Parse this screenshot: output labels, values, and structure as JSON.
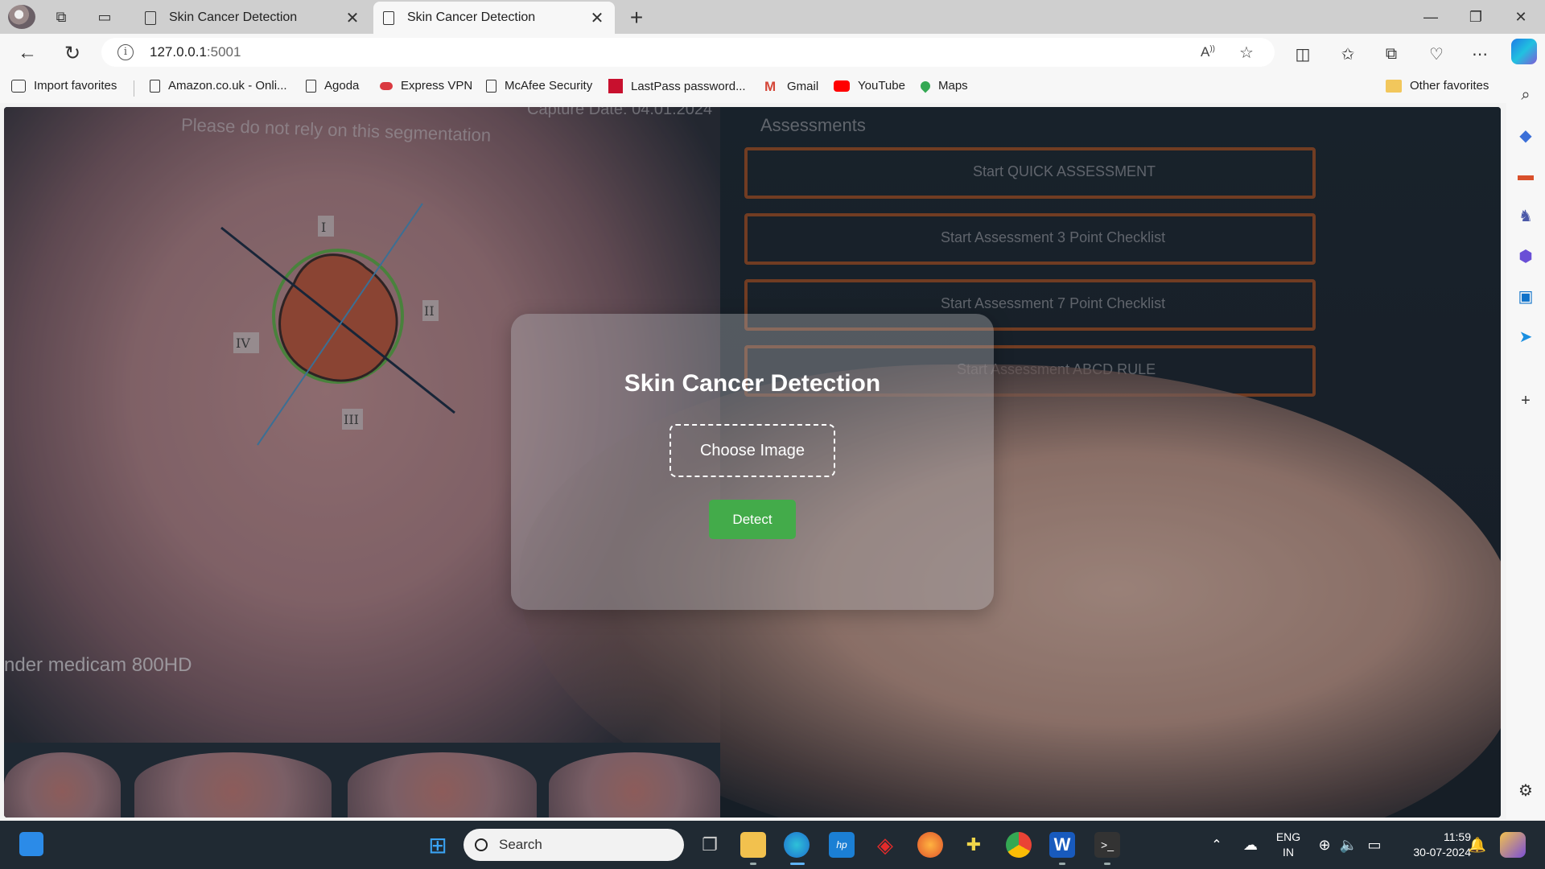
{
  "browser": {
    "tabs": [
      {
        "label": "Skin Cancer Detection",
        "active": false
      },
      {
        "label": "Skin Cancer Detection",
        "active": true
      }
    ],
    "new_tab": "+",
    "address": {
      "host": "127.0.0.1",
      "port": ":5001"
    },
    "favorites": [
      {
        "label": "Import favorites",
        "icon": "import-icon"
      },
      {
        "label": "Amazon.co.uk - Onli...",
        "icon": "page-icon"
      },
      {
        "label": "Agoda",
        "icon": "page-icon"
      },
      {
        "label": "Express VPN",
        "icon": "expressvpn-icon"
      },
      {
        "label": "McAfee Security",
        "icon": "page-icon"
      },
      {
        "label": "LastPass password...",
        "icon": "lastpass-icon"
      },
      {
        "label": "Gmail",
        "icon": "gmail-icon"
      },
      {
        "label": "YouTube",
        "icon": "youtube-icon"
      },
      {
        "label": "Maps",
        "icon": "maps-icon"
      }
    ],
    "other_favorites": "Other favorites"
  },
  "background": {
    "top_text": "Please do not rely on this segmentation",
    "capture_text": "Capture Date: 04.01.2024",
    "assessments_title": "Assessments",
    "device_text": "nder medicam 800HD",
    "assessment_items": [
      "Start QUICK ASSESSMENT",
      "Start Assessment 3 Point Checklist",
      "Start Assessment 7 Point Checklist",
      "Start Assessment ABCD RULE"
    ],
    "roman_labels": [
      "I",
      "II",
      "III",
      "IV"
    ]
  },
  "app": {
    "title": "Skin Cancer Detection",
    "choose_label": "Choose Image",
    "detect_label": "Detect"
  },
  "taskbar": {
    "search_placeholder": "Search",
    "lang_line1": "ENG",
    "lang_line2": "IN",
    "time": "11:59",
    "date": "30-07-2024"
  },
  "colors": {
    "accent_green": "#43ab4a",
    "assessment_border": "#a85226",
    "taskbar": "#202a33"
  }
}
